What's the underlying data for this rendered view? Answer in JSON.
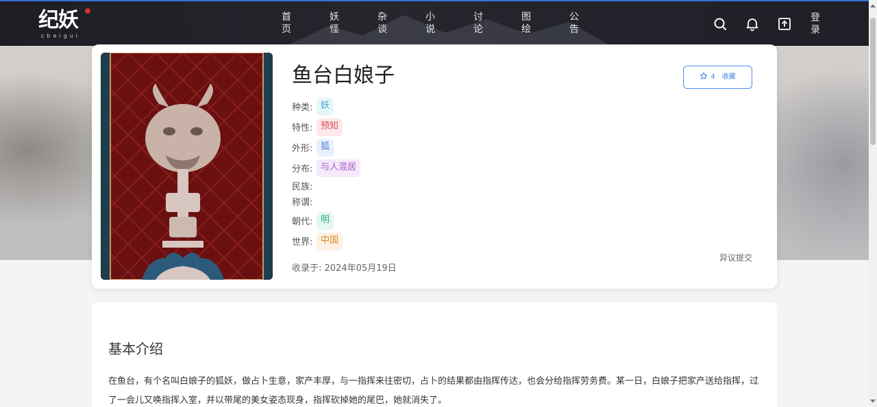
{
  "brand": {
    "logo_text": "纪妖",
    "logo_sub": "cbeigui"
  },
  "nav": {
    "items": [
      {
        "chars": [
          "首",
          "页"
        ]
      },
      {
        "chars": [
          "妖",
          "怪"
        ]
      },
      {
        "chars": [
          "杂",
          "谈"
        ]
      },
      {
        "chars": [
          "小",
          "说"
        ]
      },
      {
        "chars": [
          "讨",
          "论"
        ]
      },
      {
        "chars": [
          "图",
          "绘"
        ]
      },
      {
        "chars": [
          "公",
          "告"
        ]
      }
    ],
    "login_chars": [
      "登",
      "录"
    ]
  },
  "entry": {
    "title": "鱼台白娘子",
    "favorite": {
      "count": "4",
      "label": "收藏"
    },
    "attributes": [
      {
        "label": "种类:",
        "tags": [
          {
            "text": "妖",
            "bg": "#e6f7fb",
            "fg": "#3aa6c2"
          }
        ]
      },
      {
        "label": "特性:",
        "tags": [
          {
            "text": "预知",
            "bg": "#fde8ea",
            "fg": "#d94b57"
          }
        ]
      },
      {
        "label": "外形:",
        "tags": [
          {
            "text": "狐",
            "bg": "#e8f0fd",
            "fg": "#4a7fd6"
          }
        ]
      },
      {
        "label": "分布:",
        "tags": [
          {
            "text": "与人混居",
            "bg": "#f5e9fb",
            "fg": "#a560c7"
          }
        ]
      },
      {
        "label": "民族:",
        "tags": []
      },
      {
        "label": "称谓:",
        "tags": []
      },
      {
        "label": "朝代:",
        "tags": [
          {
            "text": "明",
            "bg": "#e4f7f2",
            "fg": "#2aa685"
          }
        ]
      },
      {
        "label": "世界:",
        "tags": [
          {
            "text": "中国",
            "bg": "#fdf1e2",
            "fg": "#d58a2a"
          }
        ]
      }
    ],
    "recorded": "收录于: 2024年05月19日",
    "report_label": "异议提交"
  },
  "intro": {
    "title": "基本介绍",
    "text": "在鱼台，有个名叫白娘子的狐妖，做占卜生意，家产丰厚，与一指挥来往密切，占卜的结果都由指挥传达，也会分给指挥劳务费。某一日，白娘子把家产送给指挥，过了一会儿又唤指挥入室，并以带尾的美女姿态现身，指挥砍掉她的尾巴，她就消失了。"
  },
  "colors": {
    "accent": "#3f7fe0",
    "topbar": "#1f1f27"
  }
}
